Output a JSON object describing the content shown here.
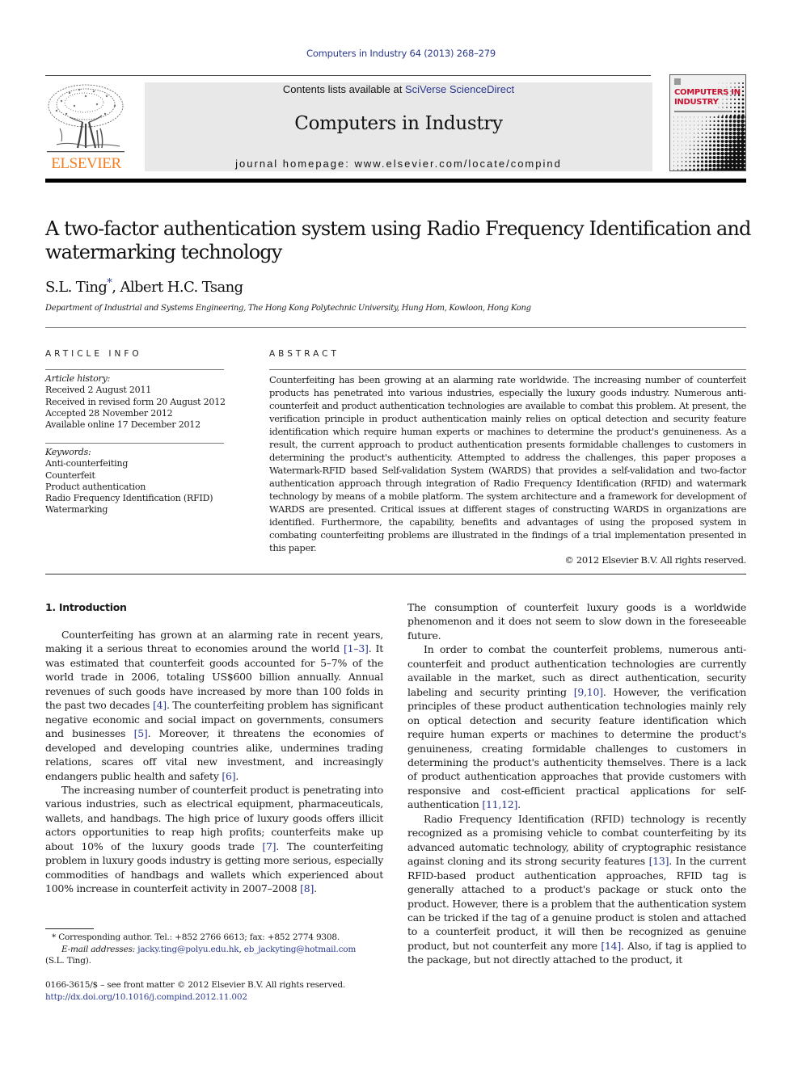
{
  "journal_header": {
    "citation": "Computers in Industry 64 (2013) 268–279",
    "publisher_logo_text": "ELSEVIER",
    "contents_prefix": "Contents lists available at ",
    "contents_link": "SciVerse ScienceDirect",
    "journal_title": "Computers in Industry",
    "homepage_prefix": "journal homepage: ",
    "homepage_url": "www.elsevier.com/locate/compind",
    "cover_title_line1": "COMPUTERS IN",
    "cover_title_line2": "INDUSTRY"
  },
  "article": {
    "title": "A two-factor authentication system using Radio Frequency Identification and watermarking technology",
    "author1": "S.L. Ting",
    "author1_mark": "*",
    "author_sep": ", ",
    "author2": "Albert H.C. Tsang",
    "affiliation": "Department of Industrial and Systems Engineering, The Hong Kong Polytechnic University, Hung Hom, Kowloon, Hong Kong"
  },
  "article_info": {
    "heading": "ARTICLE INFO",
    "history_label": "Article history:",
    "history": [
      "Received 2 August 2011",
      "Received in revised form 20 August 2012",
      "Accepted 28 November 2012",
      "Available online 17 December 2012"
    ],
    "keywords_label": "Keywords:",
    "keywords": [
      "Anti-counterfeiting",
      "Counterfeit",
      "Product authentication",
      "Radio Frequency Identification (RFID)",
      "Watermarking"
    ]
  },
  "abstract": {
    "heading": "ABSTRACT",
    "text": "Counterfeiting has been growing at an alarming rate worldwide. The increasing number of counterfeit products has penetrated into various industries, especially the luxury goods industry. Numerous anti-counterfeit and product authentication technologies are available to combat this problem. At present, the verification principle in product authentication mainly relies on optical detection and security feature identification which require human experts or machines to determine the product's genuineness. As a result, the current approach to product authentication presents formidable challenges to customers in determining the product's authenticity. Attempted to address the challenges, this paper proposes a Watermark-RFID based Self-validation System (WARDS) that provides a self-validation and two-factor authentication approach through integration of Radio Frequency Identification (RFID) and watermark technology by means of a mobile platform. The system architecture and a framework for development of WARDS are presented. Critical issues at different stages of constructing WARDS in organizations are identified. Furthermore, the capability, benefits and advantages of using the proposed system in combating counterfeiting problems are illustrated in the findings of a trial implementation presented in this paper.",
    "copyright": "© 2012 Elsevier B.V. All rights reserved."
  },
  "body": {
    "section_heading": "1.  Introduction",
    "left": {
      "p1_a": "Counterfeiting has grown at an alarming rate in recent years, making it a serious threat to economies around the world ",
      "p1_ref1": "[1–3]",
      "p1_b": ". It was estimated that counterfeit goods accounted for 5–7% of the world trade in 2006, totaling US$600 billion annually. Annual revenues of such goods have increased by more than 100 folds in the past two decades ",
      "p1_ref2": "[4]",
      "p1_c": ". The counterfeiting problem has significant negative economic and social impact on governments, consumers and businesses ",
      "p1_ref3": "[5]",
      "p1_d": ". Moreover, it threatens the economies of developed and developing countries alike, undermines trading relations, scares off vital new investment, and increasingly endangers public health and safety ",
      "p1_ref4": "[6]",
      "p1_e": ".",
      "p2_a": "The increasing number of counterfeit product is penetrating into various industries, such as electrical equipment, pharmaceuticals, wallets, and handbags. The high price of luxury goods offers illicit actors opportunities to reap high profits; counterfeits make up about 10% of the luxury goods trade ",
      "p2_ref1": "[7]",
      "p2_b": ". The counterfeiting problem in luxury goods industry is getting more serious, especially commodities of handbags and wallets which experienced about 100% increase in counterfeit activity in 2007–2008 ",
      "p2_ref2": "[8]",
      "p2_c": "."
    },
    "right": {
      "p1": "The consumption of counterfeit luxury goods is a worldwide phenomenon and it does not seem to slow down in the foreseeable future.",
      "p2_a": "In order to combat the counterfeit problems, numerous anti-counterfeit and product authentication technologies are currently available in the market, such as direct authentication, security labeling and security printing ",
      "p2_ref1": "[9,10]",
      "p2_b": ". However, the verification principles of these product authentication technologies mainly rely on optical detection and security feature identification which require human experts or machines to determine the product's genuineness, creating formidable challenges to customers in determining the product's authenticity themselves. There is a lack of product authentication approaches that provide customers with responsive and cost-efficient practical applications for self-authentication ",
      "p2_ref2": "[11,12]",
      "p2_c": ".",
      "p3_a": "Radio Frequency Identification (RFID) technology is recently recognized as a promising vehicle to combat counterfeiting by its advanced automatic technology, ability of cryptographic resistance against cloning and its strong security features ",
      "p3_ref1": "[13]",
      "p3_b": ". In the current RFID-based product authentication approaches, RFID tag is generally attached to a product's package or stuck onto the product. However, there is a problem that the authentication system can be tricked if the tag of a genuine product is stolen and attached to a counterfeit product, it will then be recognized as genuine product, but not counterfeit any more ",
      "p3_ref2": "[14]",
      "p3_c": ". Also, if tag is applied to the package, but not directly attached to the product, it"
    }
  },
  "footnote": {
    "mark": "*",
    "text": " Corresponding author. Tel.: +852 2766 6613; fax: +852 2774 9308.",
    "email_label": "E-mail addresses: ",
    "email1": "jacky.ting@polyu.edu.hk",
    "email_sep": ", ",
    "email2": "eb_jackyting@hotmail.com",
    "email_owner": "(S.L. Ting)."
  },
  "front_matter": {
    "issn_line": "0166-3615/$ – see front matter © 2012 Elsevier B.V. All rights reserved.",
    "doi": "http://dx.doi.org/10.1016/j.compind.2012.11.002"
  },
  "colors": {
    "link": "#2b3990",
    "elsevier_orange": "#f47d20",
    "cover_red": "#c8102e",
    "banner_bg": "#e8e8e8"
  }
}
